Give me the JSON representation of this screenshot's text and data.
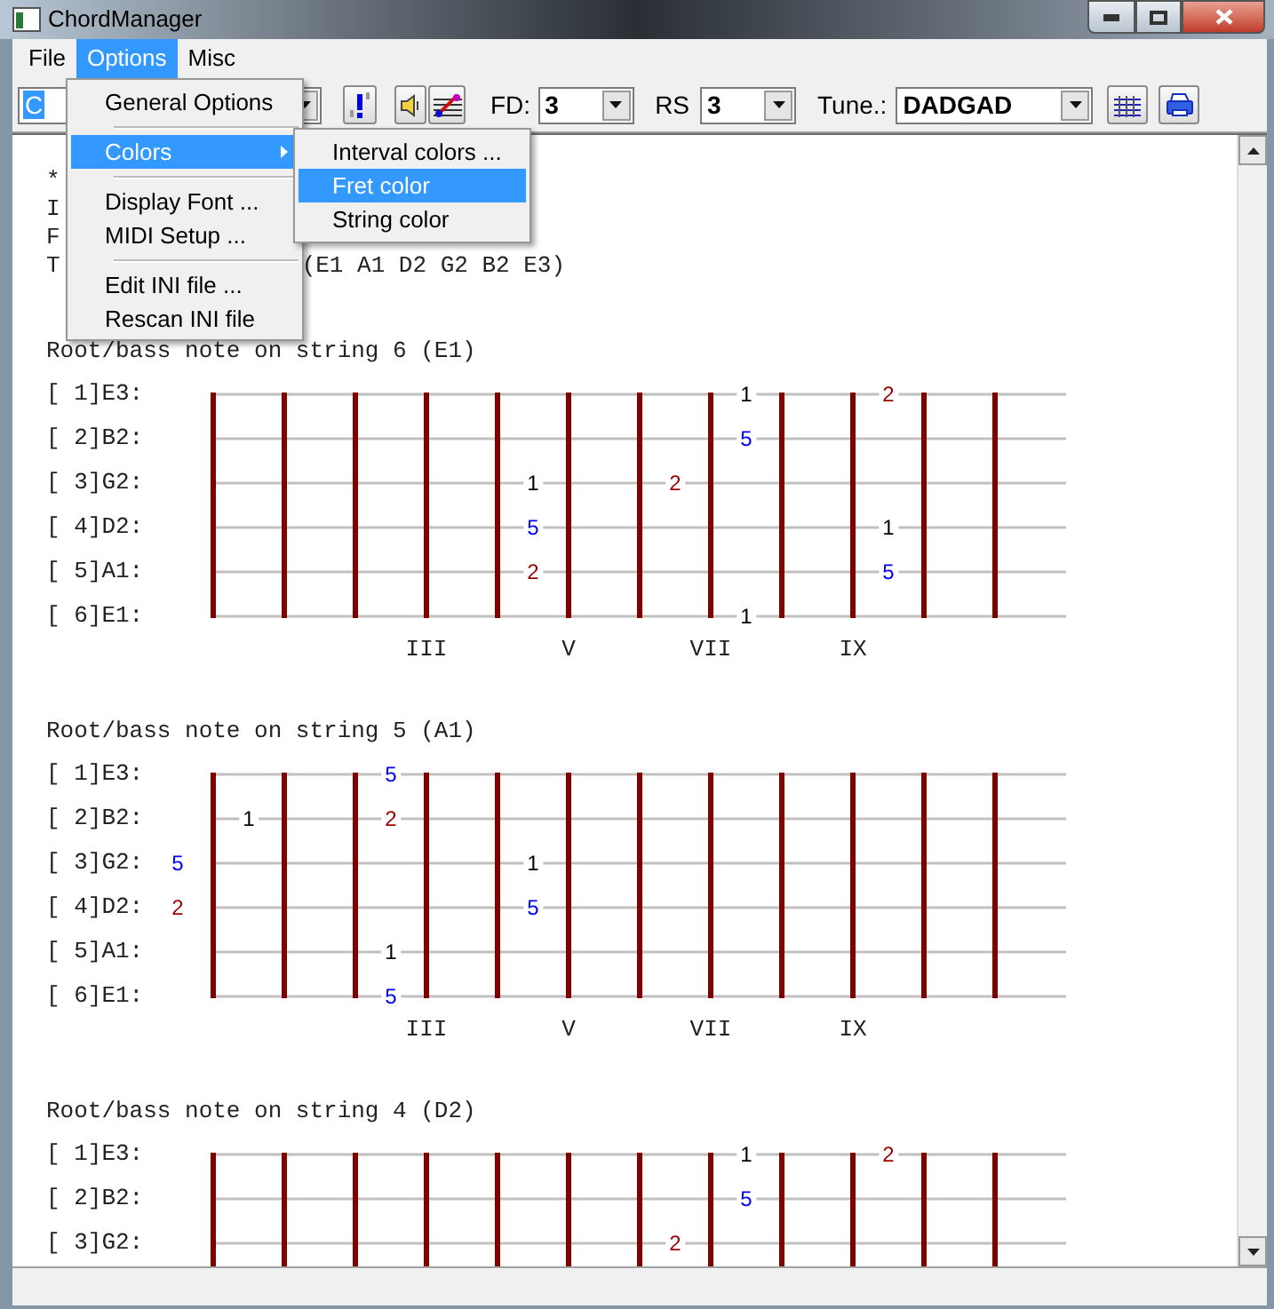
{
  "window": {
    "title": "ChordManager"
  },
  "menu_bar": [
    {
      "label": "File",
      "selected": false
    },
    {
      "label": "Options",
      "selected": true
    },
    {
      "label": "Misc",
      "selected": false
    }
  ],
  "toolbar": {
    "key": {
      "value": "C"
    },
    "fd": {
      "label": "FD:",
      "value": "3"
    },
    "rs": {
      "label": "RS",
      "value": "3"
    },
    "tune": {
      "label": "Tune.:",
      "value": "DADGAD"
    }
  },
  "options_menu": [
    {
      "kind": "item",
      "label": "General Options",
      "selected": false
    },
    {
      "kind": "separator"
    },
    {
      "kind": "submenu",
      "label": "Colors",
      "selected": true
    },
    {
      "kind": "separator"
    },
    {
      "kind": "item",
      "label": "Display Font ...",
      "selected": false
    },
    {
      "kind": "item",
      "label": "MIDI Setup ...",
      "selected": false
    },
    {
      "kind": "separator"
    },
    {
      "kind": "item",
      "label": "Edit INI file ...",
      "selected": false
    },
    {
      "kind": "item",
      "label": "Rescan INI file",
      "selected": false
    }
  ],
  "colors_submenu": [
    {
      "label": "Interval colors ...",
      "selected": false
    },
    {
      "label": "Fret color",
      "selected": true
    },
    {
      "label": "String color",
      "selected": false
    }
  ],
  "content": {
    "header_lines": [
      "*",
      "I",
      "F",
      "T"
    ],
    "tuning_suffix": "(E1 A1 D2 G2 B2 E3)",
    "sections": [
      {
        "heading": "Root/bass note on string 6 (E1)",
        "strings": [
          {
            "label": "[ 1]E3:",
            "cells": [
              {
                "kind": "empty"
              },
              {
                "kind": "empty"
              },
              {
                "kind": "empty"
              },
              {
                "kind": "empty"
              },
              {
                "kind": "empty"
              },
              {
                "kind": "empty"
              },
              {
                "kind": "empty"
              },
              {
                "kind": "empty"
              },
              {
                "kind": "note",
                "text": "1",
                "color": "#000000"
              },
              {
                "kind": "empty"
              },
              {
                "kind": "note",
                "text": "2",
                "color": "#990000"
              }
            ]
          },
          {
            "label": "[ 2]B2:",
            "cells": [
              {
                "kind": "empty"
              },
              {
                "kind": "empty"
              },
              {
                "kind": "empty"
              },
              {
                "kind": "empty"
              },
              {
                "kind": "empty"
              },
              {
                "kind": "empty"
              },
              {
                "kind": "empty"
              },
              {
                "kind": "empty"
              },
              {
                "kind": "note",
                "text": "5",
                "color": "#0000ff"
              }
            ]
          },
          {
            "label": "[ 3]G2:",
            "cells": [
              {
                "kind": "empty"
              },
              {
                "kind": "empty"
              },
              {
                "kind": "empty"
              },
              {
                "kind": "empty"
              },
              {
                "kind": "empty"
              },
              {
                "kind": "note",
                "text": "1",
                "color": "#000000"
              },
              {
                "kind": "empty"
              },
              {
                "kind": "note",
                "text": "2",
                "color": "#990000"
              }
            ]
          },
          {
            "label": "[ 4]D2:",
            "cells": [
              {
                "kind": "empty"
              },
              {
                "kind": "empty"
              },
              {
                "kind": "empty"
              },
              {
                "kind": "empty"
              },
              {
                "kind": "empty"
              },
              {
                "kind": "note",
                "text": "5",
                "color": "#0000ff"
              },
              {
                "kind": "empty"
              },
              {
                "kind": "empty"
              },
              {
                "kind": "empty"
              },
              {
                "kind": "empty"
              },
              {
                "kind": "note",
                "text": "1",
                "color": "#000000"
              }
            ]
          },
          {
            "label": "[ 5]A1:",
            "cells": [
              {
                "kind": "empty"
              },
              {
                "kind": "empty"
              },
              {
                "kind": "empty"
              },
              {
                "kind": "empty"
              },
              {
                "kind": "empty"
              },
              {
                "kind": "note",
                "text": "2",
                "color": "#990000"
              },
              {
                "kind": "empty"
              },
              {
                "kind": "empty"
              },
              {
                "kind": "empty"
              },
              {
                "kind": "empty"
              },
              {
                "kind": "note",
                "text": "5",
                "color": "#0000ff"
              }
            ]
          },
          {
            "label": "[ 6]E1:",
            "cells": [
              {
                "kind": "empty"
              },
              {
                "kind": "empty"
              },
              {
                "kind": "empty"
              },
              {
                "kind": "empty"
              },
              {
                "kind": "empty"
              },
              {
                "kind": "empty"
              },
              {
                "kind": "empty"
              },
              {
                "kind": "empty"
              },
              {
                "kind": "note",
                "text": "1",
                "color": "#000000"
              }
            ]
          }
        ],
        "position_markers": [
          "III",
          "V",
          "VII",
          "IX"
        ]
      },
      {
        "heading": "Root/bass note on string 5 (A1)",
        "strings": [
          {
            "label": "[ 1]E3:",
            "cells": [
              {
                "kind": "empty"
              },
              {
                "kind": "empty"
              },
              {
                "kind": "empty"
              },
              {
                "kind": "note",
                "text": "5",
                "color": "#0000ff"
              }
            ]
          },
          {
            "label": "[ 2]B2:",
            "cells": [
              {
                "kind": "empty"
              },
              {
                "kind": "note",
                "text": "1",
                "color": "#000000"
              },
              {
                "kind": "empty"
              },
              {
                "kind": "note",
                "text": "2",
                "color": "#990000"
              }
            ]
          },
          {
            "label": "[ 3]G2:",
            "cells": [
              {
                "kind": "note",
                "text": "5",
                "color": "#0000ff"
              },
              {
                "kind": "empty"
              },
              {
                "kind": "empty"
              },
              {
                "kind": "empty"
              },
              {
                "kind": "empty"
              },
              {
                "kind": "note",
                "text": "1",
                "color": "#000000"
              }
            ]
          },
          {
            "label": "[ 4]D2:",
            "cells": [
              {
                "kind": "note",
                "text": "2",
                "color": "#990000"
              },
              {
                "kind": "empty"
              },
              {
                "kind": "empty"
              },
              {
                "kind": "empty"
              },
              {
                "kind": "empty"
              },
              {
                "kind": "note",
                "text": "5",
                "color": "#0000ff"
              }
            ]
          },
          {
            "label": "[ 5]A1:",
            "cells": [
              {
                "kind": "empty"
              },
              {
                "kind": "empty"
              },
              {
                "kind": "empty"
              },
              {
                "kind": "note",
                "text": "1",
                "color": "#000000"
              }
            ]
          },
          {
            "label": "[ 6]E1:",
            "cells": [
              {
                "kind": "empty"
              },
              {
                "kind": "empty"
              },
              {
                "kind": "empty"
              },
              {
                "kind": "note",
                "text": "5",
                "color": "#0000ff"
              }
            ]
          }
        ],
        "position_markers": [
          "III",
          "V",
          "VII",
          "IX"
        ]
      },
      {
        "heading": "Root/bass note on string 4 (D2)",
        "strings": [
          {
            "label": "[ 1]E3:",
            "cells": [
              {
                "kind": "empty"
              },
              {
                "kind": "empty"
              },
              {
                "kind": "empty"
              },
              {
                "kind": "empty"
              },
              {
                "kind": "empty"
              },
              {
                "kind": "empty"
              },
              {
                "kind": "empty"
              },
              {
                "kind": "empty"
              },
              {
                "kind": "note",
                "text": "1",
                "color": "#000000"
              },
              {
                "kind": "empty"
              },
              {
                "kind": "note",
                "text": "2",
                "color": "#990000"
              }
            ]
          },
          {
            "label": "[ 2]B2:",
            "cells": [
              {
                "kind": "empty"
              },
              {
                "kind": "empty"
              },
              {
                "kind": "empty"
              },
              {
                "kind": "empty"
              },
              {
                "kind": "empty"
              },
              {
                "kind": "empty"
              },
              {
                "kind": "empty"
              },
              {
                "kind": "empty"
              },
              {
                "kind": "note",
                "text": "5",
                "color": "#0000ff"
              }
            ]
          },
          {
            "label": "[ 3]G2:",
            "cells": [
              {
                "kind": "empty"
              },
              {
                "kind": "empty"
              },
              {
                "kind": "empty"
              },
              {
                "kind": "empty"
              },
              {
                "kind": "empty"
              },
              {
                "kind": "empty"
              },
              {
                "kind": "empty"
              },
              {
                "kind": "note",
                "text": "2",
                "color": "#990000"
              }
            ]
          }
        ]
      }
    ]
  }
}
